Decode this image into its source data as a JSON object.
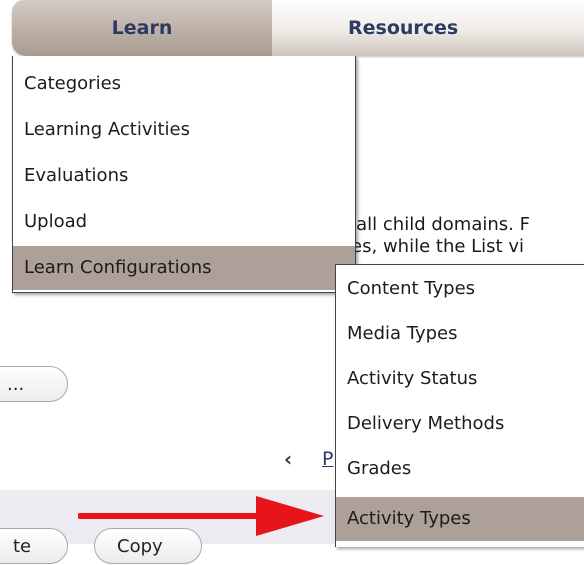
{
  "nav": {
    "tabs": [
      {
        "label": "Learn",
        "active": true
      },
      {
        "label": "Resources",
        "active": false
      }
    ]
  },
  "learn_menu": {
    "items": [
      {
        "label": "Categories"
      },
      {
        "label": "Learning Activities"
      },
      {
        "label": "Evaluations"
      },
      {
        "label": "Upload"
      },
      {
        "label": "Learn Configurations",
        "highlighted": true
      }
    ]
  },
  "config_submenu": {
    "items": [
      {
        "label": "Content Types"
      },
      {
        "label": "Media Types"
      },
      {
        "label": "Activity Status"
      },
      {
        "label": "Delivery Methods"
      },
      {
        "label": "Grades"
      },
      {
        "label": "Activity Types",
        "highlighted": true
      }
    ]
  },
  "background": {
    "line1": "d all child domains. F",
    "line2": "ties, while the List vi",
    "ellipsis_button": "...",
    "prev_icon": "‹",
    "page_link_fragment": "P",
    "bottom_button_fragment": "te",
    "copy_button": "Copy"
  },
  "annotation": {
    "arrow_color": "#e8141b",
    "arrow_icon": "red-arrow-icon"
  },
  "colors": {
    "tab_text": "#2a3c63",
    "menu_highlight": "#aca099"
  }
}
